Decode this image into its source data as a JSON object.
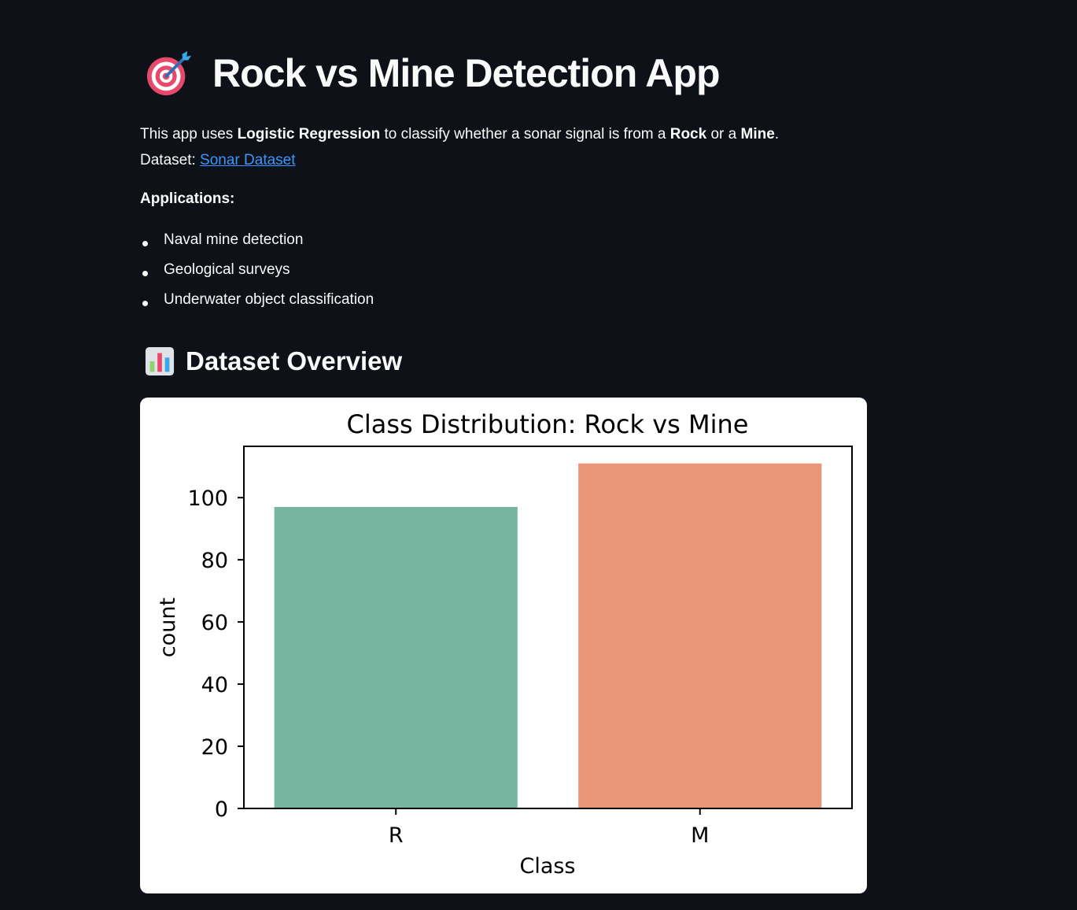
{
  "header": {
    "title": "Rock vs Mine Detection App",
    "icon": "target-dart-icon"
  },
  "intro": {
    "part1": "This app uses ",
    "model": "Logistic Regression",
    "part2": " to classify whether a sonar signal is from a ",
    "rock": "Rock",
    "part3": " or a ",
    "mine": "Mine",
    "part4": ".",
    "dataset_label": "Dataset: ",
    "dataset_link": "Sonar Dataset"
  },
  "applications": {
    "heading": "Applications:",
    "items": [
      "Naval mine detection",
      "Geological surveys",
      "Underwater object classification"
    ]
  },
  "overview": {
    "title": "Dataset Overview",
    "icon": "bar-chart-icon"
  },
  "chart_data": {
    "type": "bar",
    "title": "Class Distribution: Rock vs Mine",
    "xlabel": "Class",
    "ylabel": "count",
    "categories": [
      "R",
      "M"
    ],
    "values": [
      97,
      111
    ],
    "colors": [
      "#76b5a0",
      "#e99676"
    ],
    "ylim": [
      0,
      116.5
    ],
    "yticks": [
      0,
      20,
      40,
      60,
      80,
      100
    ],
    "grid": false
  }
}
